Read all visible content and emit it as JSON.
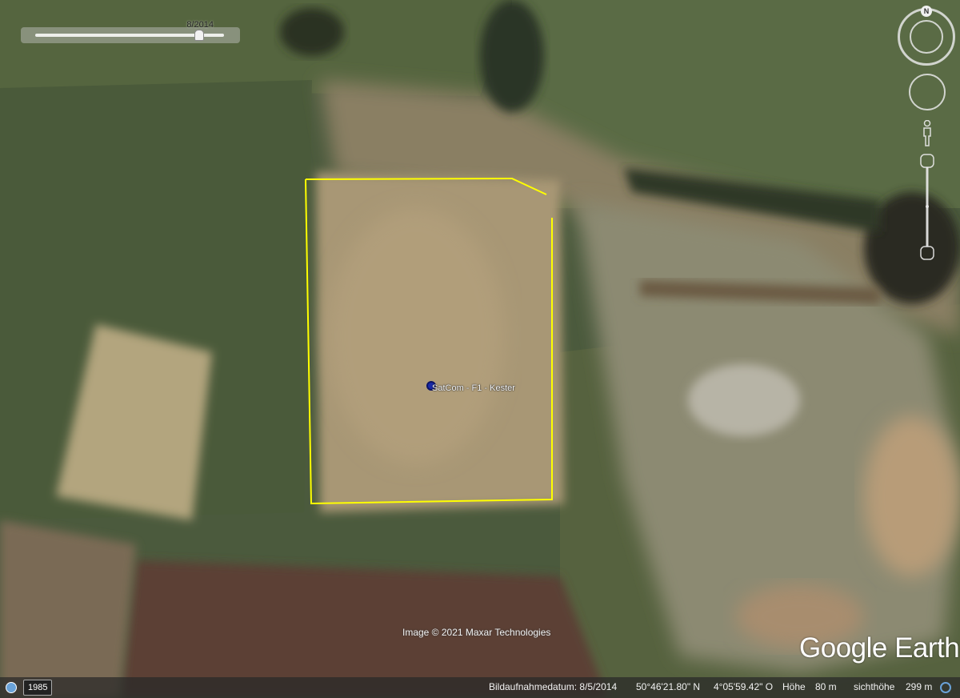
{
  "app": {
    "logo_text": "Google Earth"
  },
  "time_slider": {
    "label": "8/2014",
    "position_fraction": 0.87
  },
  "navigation": {
    "north_label": "N"
  },
  "map": {
    "placemark": {
      "label": "SatCom - F1 - Kester",
      "icon": "placemark-pin-icon",
      "color": "#1a2aa8"
    },
    "polygon": {
      "color": "#ffff00"
    },
    "imagery_credit": "Image © 2021 Maxar Technologies"
  },
  "status_bar": {
    "history_year": "1985",
    "imagery_date": "Bildaufnahmedatum: 8/5/2014",
    "latitude": "50°46'21.80\" N",
    "longitude": "4°05'59.42\" O",
    "elevation_label": "Höhe",
    "elevation_value": "80 m",
    "eye_alt_label": "sichthöhe",
    "eye_alt_value": "299 m"
  }
}
